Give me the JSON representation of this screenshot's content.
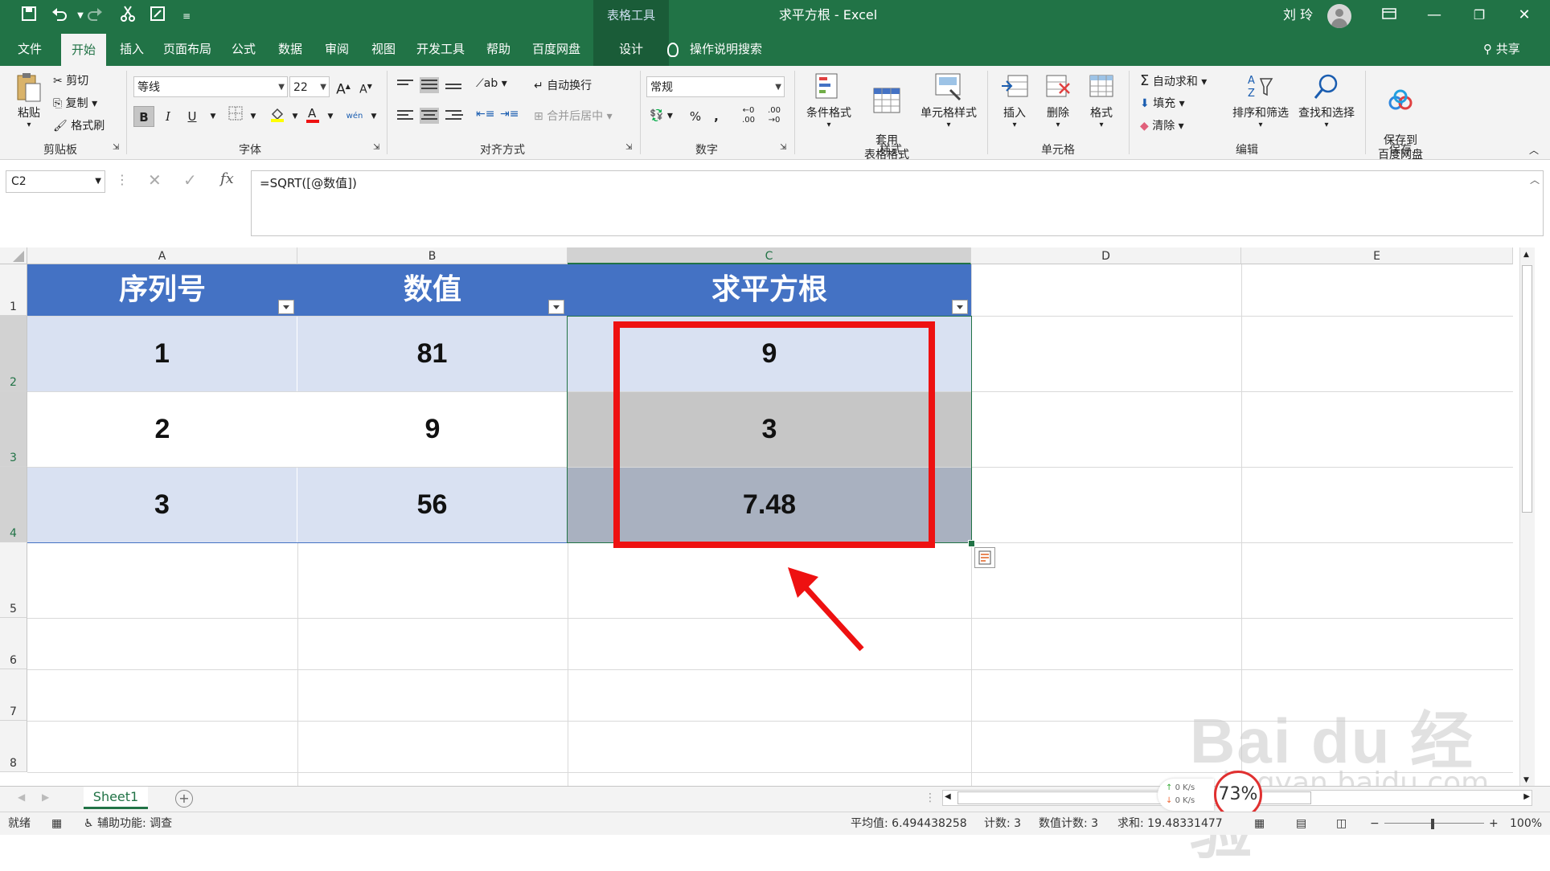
{
  "titlebar": {
    "context_tab": "表格工具",
    "doc_title": "求平方根  -  Excel",
    "user_name": "刘 玲",
    "quick_access": [
      "save-icon",
      "undo-icon",
      "redo-icon",
      "cut-icon",
      "quick-save-icon",
      "customize-icon"
    ],
    "win_buttons": [
      "▭",
      "—",
      "❐",
      "✕"
    ]
  },
  "tabs": [
    "文件",
    "开始",
    "插入",
    "页面布局",
    "公式",
    "数据",
    "审阅",
    "视图",
    "开发工具",
    "帮助",
    "百度网盘",
    "设计"
  ],
  "tell_me": "操作说明搜索",
  "share": "共享",
  "ribbon": {
    "clipboard": {
      "paste": "粘贴",
      "cut": "剪切",
      "copy": "复制",
      "format_painter": "格式刷",
      "label": "剪贴板"
    },
    "font": {
      "name": "等线",
      "size": "22",
      "label": "字体",
      "bold": "B",
      "italic": "I",
      "underline": "U",
      "grow": "A",
      "shrink": "A",
      "wen": "wén"
    },
    "alignment": {
      "wrap": "自动换行",
      "merge": "合并后居中",
      "label": "对齐方式"
    },
    "number": {
      "format": "常规",
      "label": "数字",
      "percent": "%",
      "comma": ","
    },
    "styles": {
      "cond": "条件格式",
      "table": "套用\n表格格式",
      "cell": "单元格样式",
      "label": "样式"
    },
    "cells": {
      "insert": "插入",
      "delete": "删除",
      "format": "格式",
      "label": "单元格"
    },
    "editing": {
      "autosum": "自动求和",
      "fill": "填充",
      "clear": "清除",
      "sort": "排序和筛选",
      "find": "查找和选择",
      "label": "编辑"
    },
    "save": {
      "button": "保存到\n百度网盘",
      "label": "保存"
    }
  },
  "formula_bar": {
    "name_box": "C2",
    "formula": "=SQRT([@数值])",
    "fx": "fx"
  },
  "columns": [
    "A",
    "B",
    "C",
    "D",
    "E"
  ],
  "rows": [
    "1",
    "2",
    "3",
    "4",
    "5",
    "6",
    "7",
    "8"
  ],
  "table": {
    "headers": [
      "序列号",
      "数值",
      "求平方根"
    ],
    "rows": [
      [
        "1",
        "81",
        "9"
      ],
      [
        "2",
        "9",
        "3"
      ],
      [
        "3",
        "56",
        "7.48"
      ]
    ]
  },
  "sheet_tab": "Sheet1",
  "status": {
    "ready": "就绪",
    "accessibility": "辅助功能: 调查",
    "average": "平均值: 6.494438258",
    "count": "计数: 3",
    "numeric_count": "数值计数: 3",
    "sum": "求和: 19.48331477",
    "zoom": "100%",
    "net_up": "0 K/s",
    "net_down": "0 K/s",
    "percent_badge": "73%"
  },
  "watermark": {
    "text": "Bai du 经验",
    "url": "jingyan.baidu.com"
  },
  "colors": {
    "excel_green": "#217346",
    "table_header": "#4472c4",
    "band": "#d9e1f2",
    "highlight": "#ee1111"
  }
}
